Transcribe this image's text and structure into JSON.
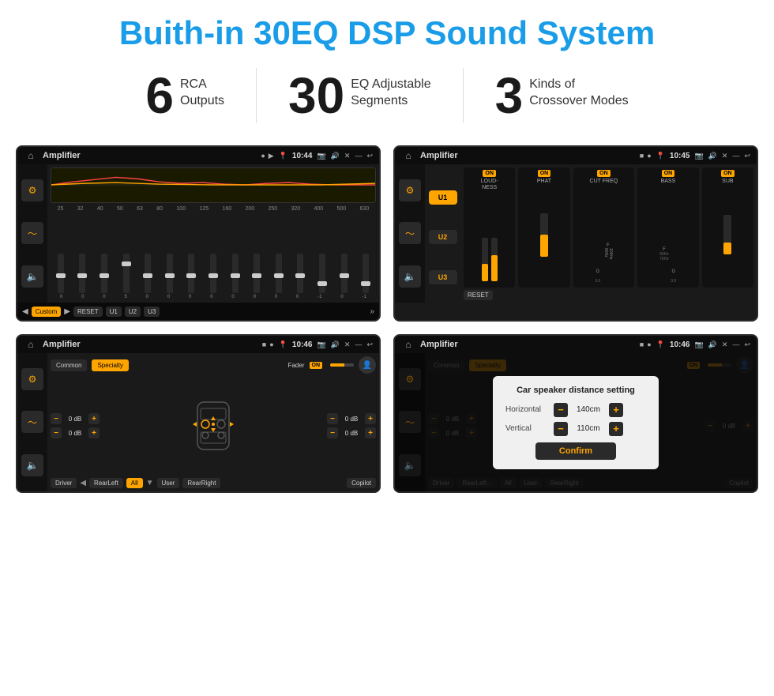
{
  "page": {
    "title": "Buith-in 30EQ DSP Sound System",
    "stats": [
      {
        "number": "6",
        "line1": "RCA",
        "line2": "Outputs"
      },
      {
        "number": "30",
        "line1": "EQ Adjustable",
        "line2": "Segments"
      },
      {
        "number": "3",
        "line1": "Kinds of",
        "line2": "Crossover Modes"
      }
    ]
  },
  "screen1": {
    "status": {
      "title": "Amplifier",
      "time": "10:44"
    },
    "freqs": [
      "25",
      "32",
      "40",
      "50",
      "63",
      "80",
      "100",
      "125",
      "160",
      "200",
      "250",
      "320",
      "400",
      "500",
      "630"
    ],
    "sliderVals": [
      "0",
      "0",
      "0",
      "5",
      "0",
      "0",
      "0",
      "0",
      "0",
      "0",
      "0",
      "0",
      "-1",
      "0",
      "-1"
    ],
    "bottomBtns": [
      "Custom",
      "RESET",
      "U1",
      "U2",
      "U3"
    ]
  },
  "screen2": {
    "status": {
      "title": "Amplifier",
      "time": "10:45"
    },
    "presets": [
      "U1",
      "U2",
      "U3"
    ],
    "controls": [
      {
        "label": "LOUDNESS",
        "on": true
      },
      {
        "label": "PHAT",
        "on": true
      },
      {
        "label": "CUT FREQ",
        "on": true
      },
      {
        "label": "BASS",
        "on": true
      },
      {
        "label": "SUB",
        "on": true
      }
    ],
    "resetBtn": "RESET"
  },
  "screen3": {
    "status": {
      "title": "Amplifier",
      "time": "10:46"
    },
    "tabs": [
      "Common",
      "Specialty"
    ],
    "faderLabel": "Fader",
    "onLabel": "ON",
    "volRows": [
      {
        "value": "0 dB"
      },
      {
        "value": "0 dB"
      },
      {
        "value": "0 dB"
      },
      {
        "value": "0 dB"
      }
    ],
    "bottomBtns": [
      "Driver",
      "RearLeft",
      "All",
      "User",
      "RearRight",
      "Copilot"
    ]
  },
  "screen4": {
    "status": {
      "title": "Amplifier",
      "time": "10:46"
    },
    "tabs": [
      "Common",
      "Specialty"
    ],
    "dialog": {
      "title": "Car speaker distance setting",
      "horizontal": {
        "label": "Horizontal",
        "value": "140cm"
      },
      "vertical": {
        "label": "Vertical",
        "value": "110cm"
      },
      "confirm": "Confirm"
    },
    "volRows": [
      {
        "value": "0 dB"
      },
      {
        "value": "0 dB"
      }
    ],
    "bottomBtns": [
      "Driver",
      "RearLeft",
      "All",
      "User",
      "RearRight",
      "Copilot"
    ]
  }
}
